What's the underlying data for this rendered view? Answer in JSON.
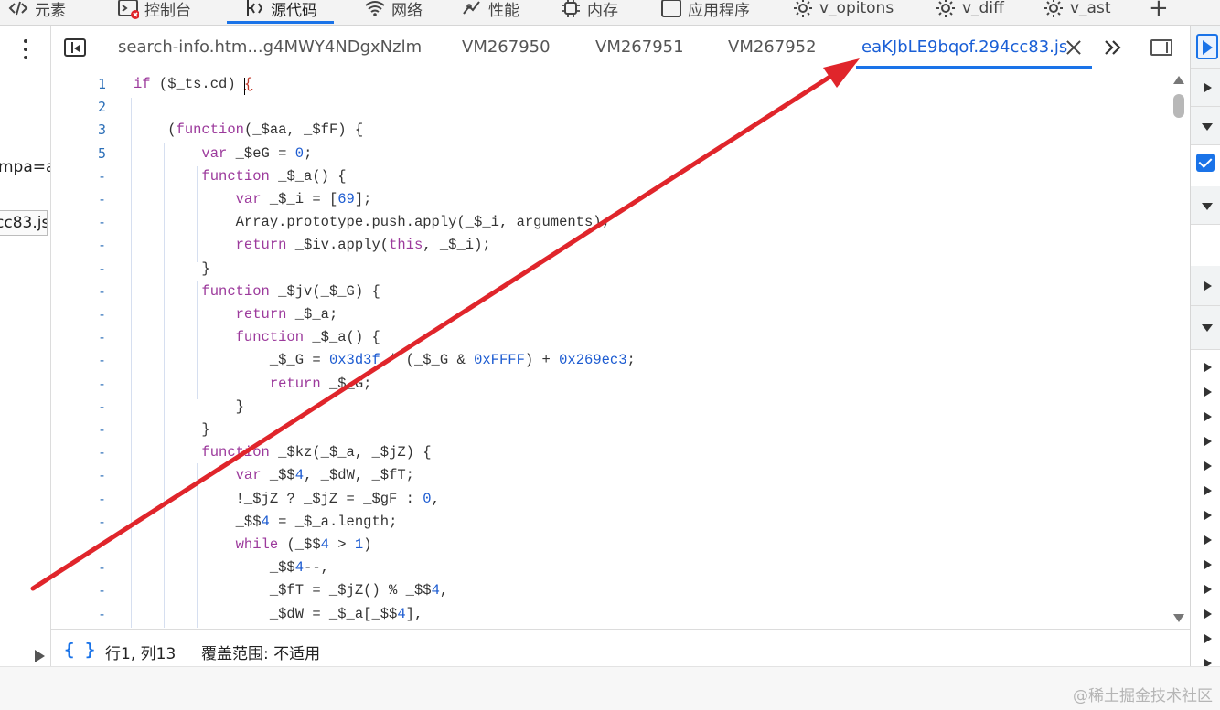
{
  "devtools_tabs": [
    {
      "label": "元素",
      "icon": "code-brackets-icon"
    },
    {
      "label": "控制台",
      "icon": "console-icon",
      "error_badge": true
    },
    {
      "label": "源代码",
      "icon": "sources-icon",
      "active": true
    },
    {
      "label": "网络",
      "icon": "wifi-icon"
    },
    {
      "label": "性能",
      "icon": "performance-icon"
    },
    {
      "label": "内存",
      "icon": "memory-chip-icon"
    },
    {
      "label": "应用程序",
      "icon": "application-icon"
    },
    {
      "label": "v_opitons",
      "icon": "gear-icon"
    },
    {
      "label": "v_diff",
      "icon": "gear-icon"
    },
    {
      "label": "v_ast",
      "icon": "gear-icon"
    },
    {
      "label": "+",
      "icon": "plus-icon"
    }
  ],
  "left_panel": {
    "fragment_1": "mpa=a",
    "fragment_2": "cc83.js"
  },
  "editor_tabs": [
    {
      "label": "search-info.htm...g4MWY4NDgxNzlm"
    },
    {
      "label": "VM267950"
    },
    {
      "label": "VM267951"
    },
    {
      "label": "VM267952"
    },
    {
      "label": "eaKJbLE9bqof.294cc83.js",
      "active": true
    }
  ],
  "editor": {
    "line_numbers": [
      "1",
      "2",
      "3",
      "5",
      "-",
      "-",
      "-",
      "-",
      "-",
      "-",
      "-",
      "-",
      "-",
      "-",
      "-",
      "-",
      "-",
      "-",
      "-",
      "-",
      "-",
      "-",
      "-",
      "-"
    ],
    "lines": [
      "if ($_ts.cd) {",
      "",
      "    (function(_$aa, _$fF) {",
      "        var _$eG = 0;",
      "        function _$_a() {",
      "            var _$_i = [69];",
      "            Array.prototype.push.apply(_$_i, arguments);",
      "            return _$iv.apply(this, _$_i);",
      "        }",
      "        function _$jv(_$_G) {",
      "            return _$_a;",
      "            function _$_a() {",
      "                _$_G = 0x3d3f * (_$_G & 0xFFFF) + 0x269ec3;",
      "                return _$_G;",
      "            }",
      "        }",
      "        function _$kz(_$_a, _$jZ) {",
      "            var _$$4, _$dW, _$fT;",
      "            !_$jZ ? _$jZ = _$gF : 0,",
      "            _$$4 = _$_a.length;",
      "            while (_$$4 > 1)",
      "                _$$4--,",
      "                _$fT = _$jZ() % _$$4,",
      "                _$dW = _$_a[_$$4],"
    ]
  },
  "status_bar": {
    "pretty_print": "{ }",
    "position": "行1, 列13",
    "coverage": "覆盖范围: 不适用"
  },
  "watermark": "@稀土掘金技术社区",
  "colors": {
    "accent": "#1a73e8",
    "annotation_arrow": "#e0252b",
    "keyword": "#9c3a9c",
    "number": "#1c5bd1"
  }
}
